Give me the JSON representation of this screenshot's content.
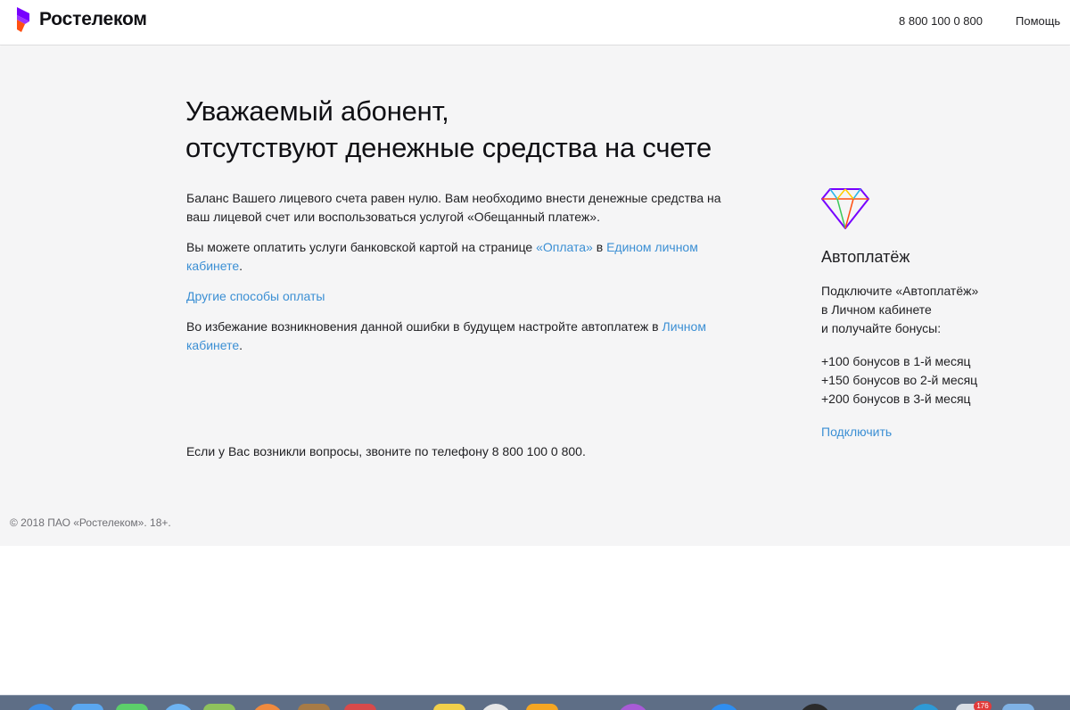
{
  "header": {
    "brand": "Ростелеком",
    "phone": "8 800 100 0 800",
    "help": "Помощь"
  },
  "main": {
    "title_line1": "Уважаемый абонент,",
    "title_line2": "отсутствуют денежные средства на счете",
    "p1": "Баланс Вашего лицевого счета равен нулю. Вам необходимо внести денежные средства на ваш лицевой счет или воспользоваться услугой «Обещанный платеж».",
    "p2_text1": "Вы можете оплатить услуги банковской картой на странице ",
    "p2_link1": "«Оплата»",
    "p2_text2": " в ",
    "p2_link2": "Едином личном кабинете",
    "p2_text3": ".",
    "p3_link": "Другие способы оплаты",
    "p4_text1": "Во избежание возникновения данной ошибки в будущем настройте автоплатеж в ",
    "p4_link": "Личном кабинете",
    "p4_text2": ".",
    "question": "Если у Вас возникли вопросы, звоните по телефону 8 800 100 0 800."
  },
  "promo": {
    "title": "Автоплатёж",
    "text_line1": "Подключите «Автоплатёж»",
    "text_line2": "в Личном кабинете",
    "text_line3": "и получайте бонусы:",
    "bonuses": [
      "+100 бонусов в 1-й месяц",
      "+150 бонусов во 2-й месяц",
      "+200 бонусов в 3-й месяц"
    ],
    "link": "Подключить",
    "icon": "diamond-icon"
  },
  "footer": {
    "copyright": "© 2018 ПАО «Ростелеком». 18+."
  },
  "dock": {
    "badge": "176"
  },
  "colors": {
    "brand_purple": "#7700ff",
    "brand_orange": "#ff4f12",
    "link": "#3b8fd4",
    "page_background": "#f5f5f6"
  }
}
